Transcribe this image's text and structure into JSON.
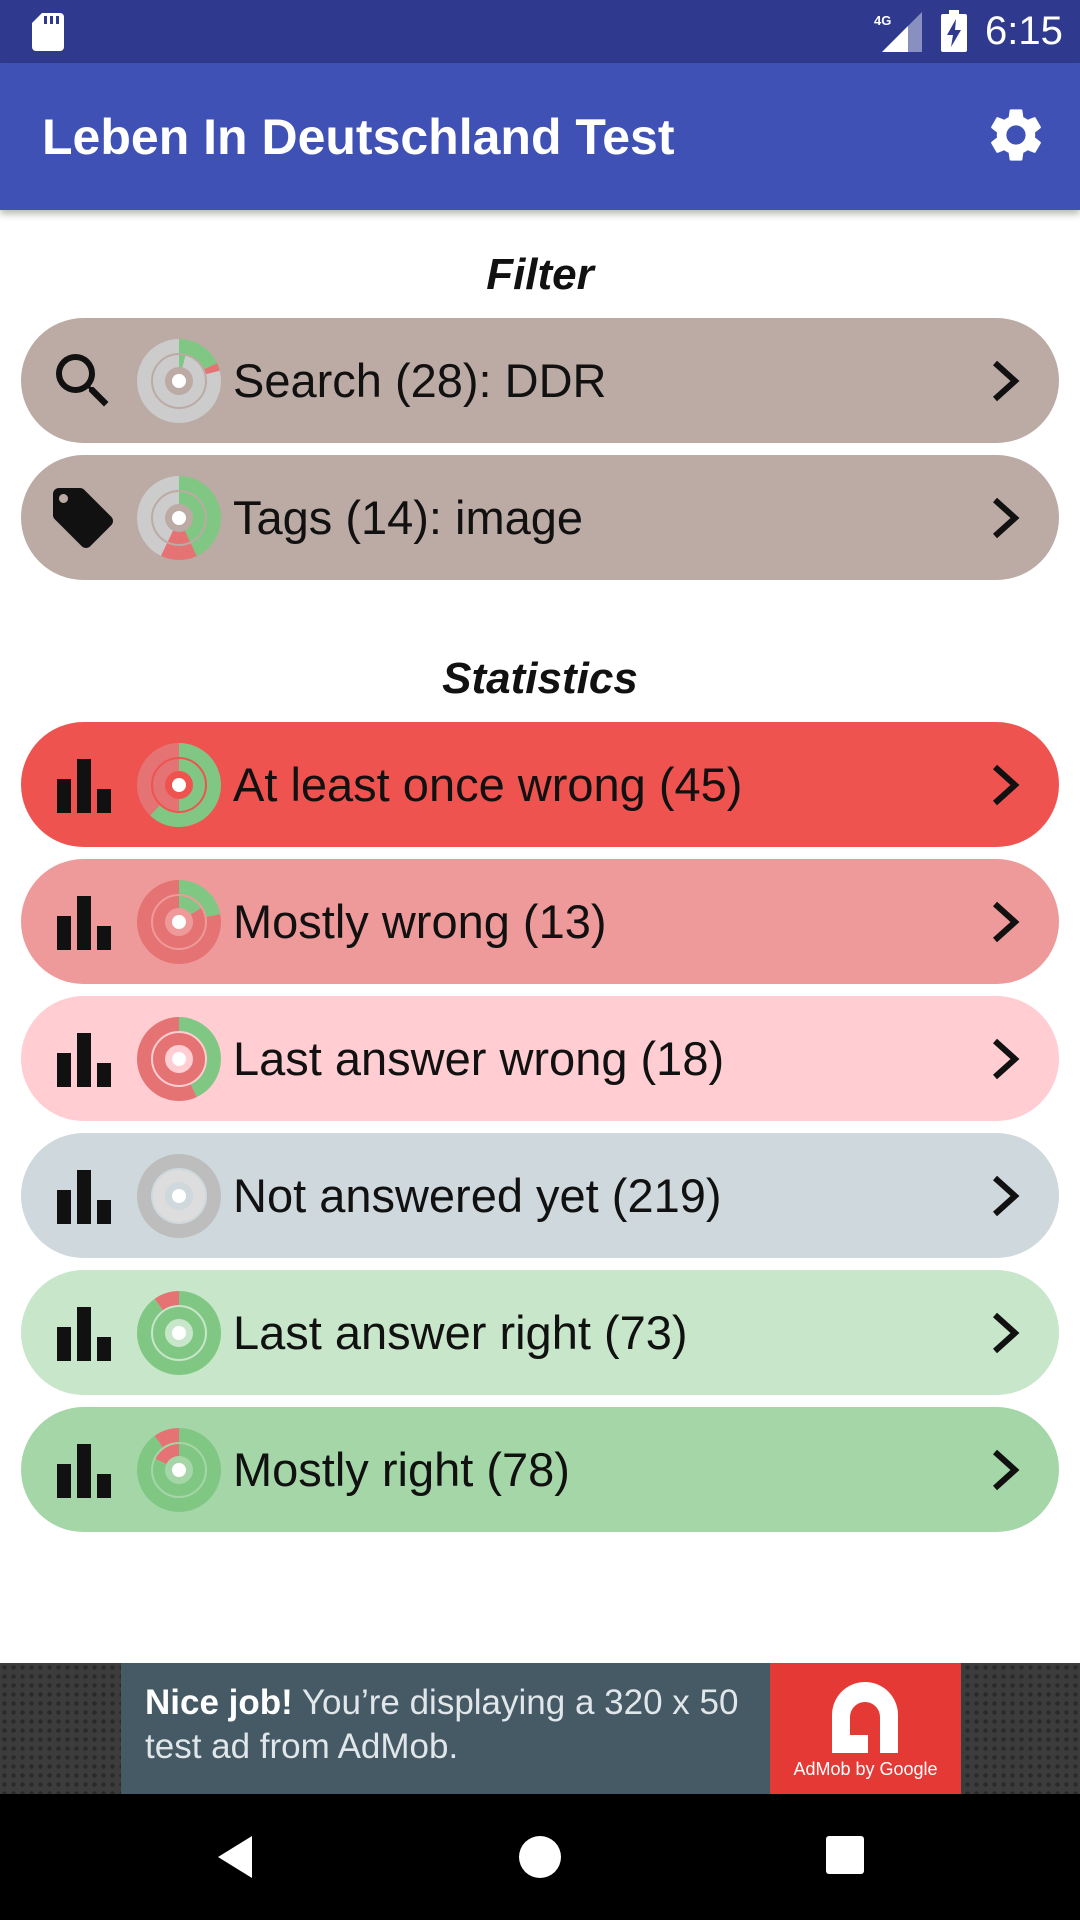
{
  "status_bar": {
    "time": "6:15",
    "network": "4G"
  },
  "app_bar": {
    "title": "Leben In Deutschland Test",
    "settings_icon": "gear-icon"
  },
  "colors": {
    "status_bar": "#2f3a8f",
    "app_bar": "#3f51b5",
    "filter_pill": "#bcaaa4",
    "green_slice": "#81c784",
    "red_slice": "#e57373",
    "grey_slice": "#cccccc"
  },
  "filter": {
    "heading": "Filter",
    "items": [
      {
        "label": "Search (28): DDR",
        "icon": "search-icon",
        "bg": "#bcaaa4",
        "chart": {
          "outer": [
            [
              "#81c784",
              0.18
            ],
            [
              "#e57373",
              0.03
            ],
            [
              "#cccccc",
              0.79
            ]
          ],
          "inner": [
            [
              "#81c784",
              0.04
            ],
            [
              "#cccccc",
              0.96
            ]
          ]
        }
      },
      {
        "label": "Tags (14): image",
        "icon": "tag-icon",
        "bg": "#bcaaa4",
        "chart": {
          "outer": [
            [
              "#81c784",
              0.43
            ],
            [
              "#e57373",
              0.14
            ],
            [
              "#cccccc",
              0.43
            ]
          ],
          "inner": [
            [
              "#81c784",
              0.43
            ],
            [
              "#e57373",
              0.14
            ],
            [
              "#cccccc",
              0.43
            ]
          ]
        }
      }
    ]
  },
  "statistics": {
    "heading": "Statistics",
    "items": [
      {
        "label": "At least once wrong (45)",
        "icon": "bar-chart-icon",
        "bg": "#ef5350",
        "chart": {
          "outer": [
            [
              "#81c784",
              0.62
            ],
            [
              "#e57373",
              0.38
            ]
          ],
          "inner": [
            [
              "#81c784",
              0.5
            ],
            [
              "#e57373",
              0.5
            ]
          ]
        }
      },
      {
        "label": "Mostly wrong (13)",
        "icon": "bar-chart-icon",
        "bg": "#ef9a9a",
        "chart": {
          "outer": [
            [
              "#81c784",
              0.22
            ],
            [
              "#e57373",
              0.78
            ]
          ],
          "inner": [
            [
              "#81c784",
              0.16
            ],
            [
              "#e57373",
              0.84
            ]
          ]
        }
      },
      {
        "label": "Last answer wrong (18)",
        "icon": "bar-chart-icon",
        "bg": "#ffcdd2",
        "chart": {
          "outer": [
            [
              "#81c784",
              0.43
            ],
            [
              "#e57373",
              0.57
            ]
          ],
          "inner": [
            [
              "#e57373",
              1.0
            ]
          ]
        }
      },
      {
        "label": "Not answered yet (219)",
        "icon": "bar-chart-icon",
        "bg": "#cfd8dc",
        "chart": {
          "outer": [
            [
              "#bdbdbd",
              1.0
            ]
          ],
          "inner": [
            [
              "#dddddd",
              1.0
            ]
          ]
        }
      },
      {
        "label": "Last answer right (73)",
        "icon": "bar-chart-icon",
        "bg": "#c8e6c9",
        "chart": {
          "outer": [
            [
              "#81c784",
              0.9
            ],
            [
              "#e57373",
              0.1
            ]
          ],
          "inner": [
            [
              "#81c784",
              1.0
            ]
          ]
        }
      },
      {
        "label": "Mostly right (78)",
        "icon": "bar-chart-icon",
        "bg": "#a5d6a7",
        "chart": {
          "outer": [
            [
              "#81c784",
              0.9
            ],
            [
              "#e57373",
              0.1
            ]
          ],
          "inner": [
            [
              "#81c784",
              0.82
            ],
            [
              "#e57373",
              0.18
            ]
          ]
        }
      }
    ]
  },
  "ad": {
    "headline": "Nice job!",
    "body": " You’re displaying a 320 x 50 test ad from AdMob.",
    "brand": "AdMob by Google"
  }
}
